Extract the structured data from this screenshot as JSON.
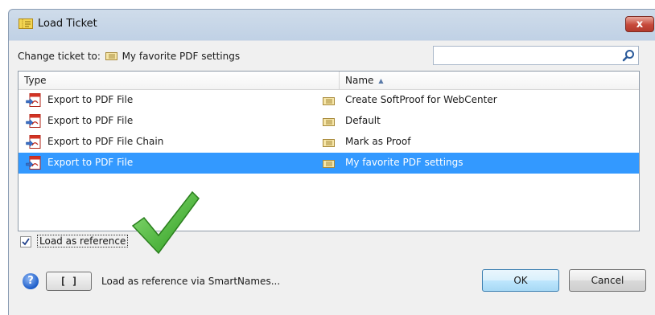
{
  "window": {
    "title": "Load Ticket",
    "close_label": "x"
  },
  "change": {
    "label": "Change ticket to:",
    "ticket_name": "My favorite PDF settings"
  },
  "search": {
    "value": "",
    "placeholder": ""
  },
  "list": {
    "columns": {
      "type": "Type",
      "name": "Name",
      "sort": "ascending"
    },
    "rows": [
      {
        "type": "Export to PDF File",
        "name": "Create SoftProof for WebCenter",
        "selected": false
      },
      {
        "type": "Export to PDF File",
        "name": "Default",
        "selected": false
      },
      {
        "type": "Export to PDF File Chain",
        "name": "Mark as Proof",
        "selected": false
      },
      {
        "type": "Export to PDF File",
        "name": "My favorite PDF settings",
        "selected": true
      }
    ]
  },
  "load_reference": {
    "label": "Load as reference",
    "checked": true
  },
  "footer": {
    "help_label": "?",
    "smartnames_button_label": "[ ]",
    "smartnames_label": "Load as reference via SmartNames...",
    "ok_label": "OK",
    "cancel_label": "Cancel"
  },
  "colors": {
    "selection": "#3399ff",
    "title_bar": "#c6d6e8",
    "check_green": "#3fae2a"
  }
}
